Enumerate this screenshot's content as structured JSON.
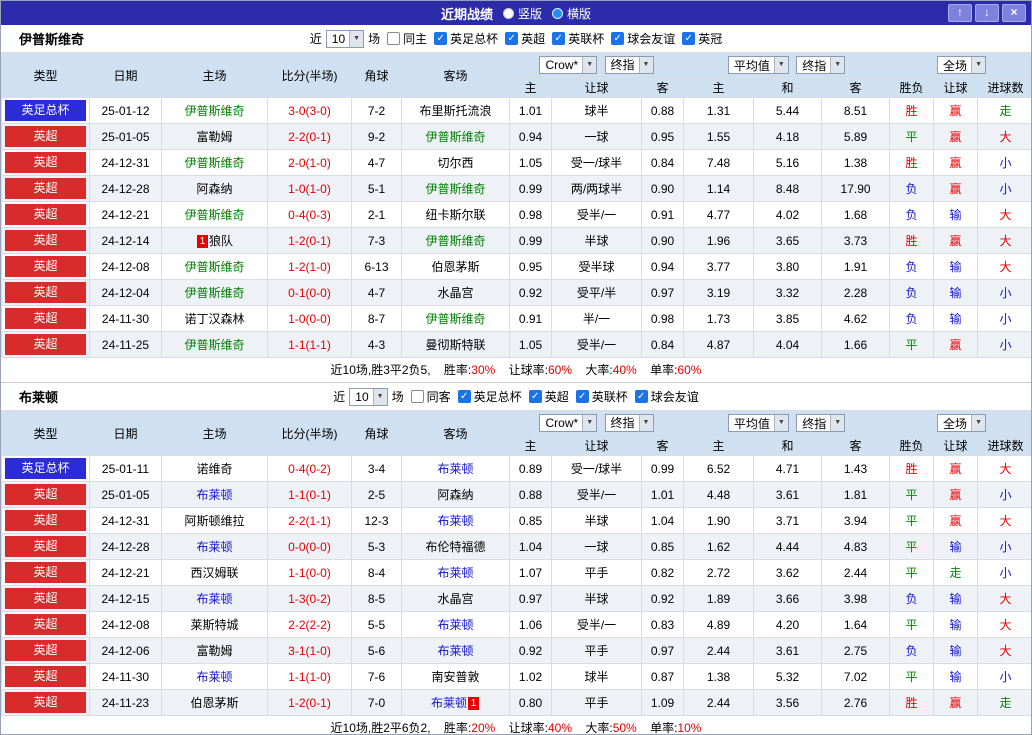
{
  "titlebar": {
    "title": "近期战绩",
    "view_options": [
      {
        "label": "竖版",
        "selected": false
      },
      {
        "label": "横版",
        "selected": true
      }
    ],
    "up_icon": "↑",
    "down_icon": "↓",
    "close_icon": "×"
  },
  "colors": {
    "titlebar_bg": "#2c2cab",
    "header_bg": "#cfe0f1",
    "league_red": "#d92b2b",
    "cup_blue": "#2b2bd9",
    "win_red": "#e60000",
    "draw_green": "#008800",
    "lose_blue": "#1414d9"
  },
  "sections": [
    {
      "team": "伊普斯维奇",
      "team_color": "#008000",
      "filter": {
        "near": "近",
        "count": "10",
        "games": "场",
        "same": {
          "label": "同主",
          "checked": false
        },
        "competitions": [
          {
            "label": "英足总杯",
            "checked": true
          },
          {
            "label": "英超",
            "checked": true
          },
          {
            "label": "英联杯",
            "checked": true
          },
          {
            "label": "球会友谊",
            "checked": true
          },
          {
            "label": "英冠",
            "checked": true
          }
        ]
      },
      "header": {
        "type": "类型",
        "date": "日期",
        "home": "主场",
        "score": "比分(半场)",
        "corner": "角球",
        "away": "客场",
        "company": "Crow*",
        "final1": "终指",
        "average": "平均值",
        "final2": "终指",
        "fulltime": "全场",
        "sub": [
          "主",
          "让球",
          "客",
          "主",
          "和",
          "客",
          "胜负",
          "让球",
          "进球数"
        ]
      },
      "rows": [
        {
          "type": "英足总杯",
          "type_color": "blue",
          "date": "25-01-12",
          "home": "伊普斯维奇",
          "home_subject": true,
          "home_card": "",
          "score": "3-0(3-0)",
          "corner": "7-2",
          "away": "布里斯托流浪",
          "away_subject": false,
          "away_card": "",
          "odds": [
            "1.01",
            "球半",
            "0.88"
          ],
          "avg": [
            "1.31",
            "5.44",
            "8.51"
          ],
          "res": [
            "胜",
            "赢",
            "走"
          ],
          "rc": [
            "red",
            "red",
            "green"
          ]
        },
        {
          "type": "英超",
          "type_color": "red",
          "date": "25-01-05",
          "home": "富勒姆",
          "home_subject": false,
          "home_card": "",
          "score": "2-2(0-1)",
          "corner": "9-2",
          "away": "伊普斯维奇",
          "away_subject": true,
          "away_card": "",
          "odds": [
            "0.94",
            "一球",
            "0.95"
          ],
          "avg": [
            "1.55",
            "4.18",
            "5.89"
          ],
          "res": [
            "平",
            "赢",
            "大"
          ],
          "rc": [
            "green",
            "red",
            "red"
          ]
        },
        {
          "type": "英超",
          "type_color": "red",
          "date": "24-12-31",
          "home": "伊普斯维奇",
          "home_subject": true,
          "home_card": "",
          "score": "2-0(1-0)",
          "corner": "4-7",
          "away": "切尔西",
          "away_subject": false,
          "away_card": "",
          "odds": [
            "1.05",
            "受一/球半",
            "0.84"
          ],
          "avg": [
            "7.48",
            "5.16",
            "1.38"
          ],
          "res": [
            "胜",
            "赢",
            "小"
          ],
          "rc": [
            "red",
            "red",
            "blue"
          ]
        },
        {
          "type": "英超",
          "type_color": "red",
          "date": "24-12-28",
          "home": "阿森纳",
          "home_subject": false,
          "home_card": "",
          "score": "1-0(1-0)",
          "corner": "5-1",
          "away": "伊普斯维奇",
          "away_subject": true,
          "away_card": "",
          "odds": [
            "0.99",
            "两/两球半",
            "0.90"
          ],
          "avg": [
            "1.14",
            "8.48",
            "17.90"
          ],
          "res": [
            "负",
            "赢",
            "小"
          ],
          "rc": [
            "blue",
            "red",
            "blue"
          ]
        },
        {
          "type": "英超",
          "type_color": "red",
          "date": "24-12-21",
          "home": "伊普斯维奇",
          "home_subject": true,
          "home_card": "",
          "score": "0-4(0-3)",
          "corner": "2-1",
          "away": "纽卡斯尔联",
          "away_subject": false,
          "away_card": "",
          "odds": [
            "0.98",
            "受半/一",
            "0.91"
          ],
          "avg": [
            "4.77",
            "4.02",
            "1.68"
          ],
          "res": [
            "负",
            "输",
            "大"
          ],
          "rc": [
            "blue",
            "blue",
            "red"
          ]
        },
        {
          "type": "英超",
          "type_color": "red",
          "date": "24-12-14",
          "home": "狼队",
          "home_subject": false,
          "home_card": "1",
          "score": "1-2(0-1)",
          "corner": "7-3",
          "away": "伊普斯维奇",
          "away_subject": true,
          "away_card": "",
          "odds": [
            "0.99",
            "半球",
            "0.90"
          ],
          "avg": [
            "1.96",
            "3.65",
            "3.73"
          ],
          "res": [
            "胜",
            "赢",
            "大"
          ],
          "rc": [
            "red",
            "red",
            "red"
          ]
        },
        {
          "type": "英超",
          "type_color": "red",
          "date": "24-12-08",
          "home": "伊普斯维奇",
          "home_subject": true,
          "home_card": "",
          "score": "1-2(1-0)",
          "corner": "6-13",
          "away": "伯恩茅斯",
          "away_subject": false,
          "away_card": "",
          "odds": [
            "0.95",
            "受半球",
            "0.94"
          ],
          "avg": [
            "3.77",
            "3.80",
            "1.91"
          ],
          "res": [
            "负",
            "输",
            "大"
          ],
          "rc": [
            "blue",
            "blue",
            "red"
          ]
        },
        {
          "type": "英超",
          "type_color": "red",
          "date": "24-12-04",
          "home": "伊普斯维奇",
          "home_subject": true,
          "home_card": "",
          "score": "0-1(0-0)",
          "corner": "4-7",
          "away": "水晶宫",
          "away_subject": false,
          "away_card": "",
          "odds": [
            "0.92",
            "受平/半",
            "0.97"
          ],
          "avg": [
            "3.19",
            "3.32",
            "2.28"
          ],
          "res": [
            "负",
            "输",
            "小"
          ],
          "rc": [
            "blue",
            "blue",
            "blue"
          ]
        },
        {
          "type": "英超",
          "type_color": "red",
          "date": "24-11-30",
          "home": "诺丁汉森林",
          "home_subject": false,
          "home_card": "",
          "score": "1-0(0-0)",
          "corner": "8-7",
          "away": "伊普斯维奇",
          "away_subject": true,
          "away_card": "",
          "odds": [
            "0.91",
            "半/一",
            "0.98"
          ],
          "avg": [
            "1.73",
            "3.85",
            "4.62"
          ],
          "res": [
            "负",
            "输",
            "小"
          ],
          "rc": [
            "blue",
            "blue",
            "blue"
          ]
        },
        {
          "type": "英超",
          "type_color": "red",
          "date": "24-11-25",
          "home": "伊普斯维奇",
          "home_subject": true,
          "home_card": "",
          "score": "1-1(1-1)",
          "corner": "4-3",
          "away": "曼彻斯特联",
          "away_subject": false,
          "away_card": "",
          "odds": [
            "1.05",
            "受半/一",
            "0.84"
          ],
          "avg": [
            "4.87",
            "4.04",
            "1.66"
          ],
          "res": [
            "平",
            "赢",
            "小"
          ],
          "rc": [
            "green",
            "red",
            "blue"
          ]
        }
      ],
      "summary": {
        "record": "近10场,胜3平2负5,",
        "stats": [
          {
            "label": "胜率:",
            "value": "30%"
          },
          {
            "label": "让球率:",
            "value": "60%"
          },
          {
            "label": "大率:",
            "value": "40%"
          },
          {
            "label": "单率:",
            "value": "60%"
          }
        ]
      }
    },
    {
      "team": "布莱顿",
      "team_color": "#1414cc",
      "filter": {
        "near": "近",
        "count": "10",
        "games": "场",
        "same": {
          "label": "同客",
          "checked": false
        },
        "competitions": [
          {
            "label": "英足总杯",
            "checked": true
          },
          {
            "label": "英超",
            "checked": true
          },
          {
            "label": "英联杯",
            "checked": true
          },
          {
            "label": "球会友谊",
            "checked": true
          }
        ]
      },
      "header": {
        "type": "类型",
        "date": "日期",
        "home": "主场",
        "score": "比分(半场)",
        "corner": "角球",
        "away": "客场",
        "company": "Crow*",
        "final1": "终指",
        "average": "平均值",
        "final2": "终指",
        "fulltime": "全场",
        "sub": [
          "主",
          "让球",
          "客",
          "主",
          "和",
          "客",
          "胜负",
          "让球",
          "进球数"
        ]
      },
      "rows": [
        {
          "type": "英足总杯",
          "type_color": "blue",
          "date": "25-01-11",
          "home": "诺维奇",
          "home_subject": false,
          "home_card": "",
          "score": "0-4(0-2)",
          "corner": "3-4",
          "away": "布莱顿",
          "away_subject": true,
          "away_card": "",
          "odds": [
            "0.89",
            "受一/球半",
            "0.99"
          ],
          "avg": [
            "6.52",
            "4.71",
            "1.43"
          ],
          "res": [
            "胜",
            "赢",
            "大"
          ],
          "rc": [
            "red",
            "red",
            "red"
          ]
        },
        {
          "type": "英超",
          "type_color": "red",
          "date": "25-01-05",
          "home": "布莱顿",
          "home_subject": true,
          "home_card": "",
          "score": "1-1(0-1)",
          "corner": "2-5",
          "away": "阿森纳",
          "away_subject": false,
          "away_card": "",
          "odds": [
            "0.88",
            "受半/一",
            "1.01"
          ],
          "avg": [
            "4.48",
            "3.61",
            "1.81"
          ],
          "res": [
            "平",
            "赢",
            "小"
          ],
          "rc": [
            "green",
            "red",
            "blue"
          ]
        },
        {
          "type": "英超",
          "type_color": "red",
          "date": "24-12-31",
          "home": "阿斯顿维拉",
          "home_subject": false,
          "home_card": "",
          "score": "2-2(1-1)",
          "corner": "12-3",
          "away": "布莱顿",
          "away_subject": true,
          "away_card": "",
          "odds": [
            "0.85",
            "半球",
            "1.04"
          ],
          "avg": [
            "1.90",
            "3.71",
            "3.94"
          ],
          "res": [
            "平",
            "赢",
            "大"
          ],
          "rc": [
            "green",
            "red",
            "red"
          ]
        },
        {
          "type": "英超",
          "type_color": "red",
          "date": "24-12-28",
          "home": "布莱顿",
          "home_subject": true,
          "home_card": "",
          "score": "0-0(0-0)",
          "corner": "5-3",
          "away": "布伦特福德",
          "away_subject": false,
          "away_card": "",
          "odds": [
            "1.04",
            "一球",
            "0.85"
          ],
          "avg": [
            "1.62",
            "4.44",
            "4.83"
          ],
          "res": [
            "平",
            "输",
            "小"
          ],
          "rc": [
            "green",
            "blue",
            "blue"
          ]
        },
        {
          "type": "英超",
          "type_color": "red",
          "date": "24-12-21",
          "home": "西汉姆联",
          "home_subject": false,
          "home_card": "",
          "score": "1-1(0-0)",
          "corner": "8-4",
          "away": "布莱顿",
          "away_subject": true,
          "away_card": "",
          "odds": [
            "1.07",
            "平手",
            "0.82"
          ],
          "avg": [
            "2.72",
            "3.62",
            "2.44"
          ],
          "res": [
            "平",
            "走",
            "小"
          ],
          "rc": [
            "green",
            "green",
            "blue"
          ]
        },
        {
          "type": "英超",
          "type_color": "red",
          "date": "24-12-15",
          "home": "布莱顿",
          "home_subject": true,
          "home_card": "",
          "score": "1-3(0-2)",
          "corner": "8-5",
          "away": "水晶宫",
          "away_subject": false,
          "away_card": "",
          "odds": [
            "0.97",
            "半球",
            "0.92"
          ],
          "avg": [
            "1.89",
            "3.66",
            "3.98"
          ],
          "res": [
            "负",
            "输",
            "大"
          ],
          "rc": [
            "blue",
            "blue",
            "red"
          ]
        },
        {
          "type": "英超",
          "type_color": "red",
          "date": "24-12-08",
          "home": "莱斯特城",
          "home_subject": false,
          "home_card": "",
          "score": "2-2(2-2)",
          "corner": "5-5",
          "away": "布莱顿",
          "away_subject": true,
          "away_card": "",
          "odds": [
            "1.06",
            "受半/一",
            "0.83"
          ],
          "avg": [
            "4.89",
            "4.20",
            "1.64"
          ],
          "res": [
            "平",
            "输",
            "大"
          ],
          "rc": [
            "green",
            "blue",
            "red"
          ]
        },
        {
          "type": "英超",
          "type_color": "red",
          "date": "24-12-06",
          "home": "富勒姆",
          "home_subject": false,
          "home_card": "",
          "score": "3-1(1-0)",
          "corner": "5-6",
          "away": "布莱顿",
          "away_subject": true,
          "away_card": "",
          "odds": [
            "0.92",
            "平手",
            "0.97"
          ],
          "avg": [
            "2.44",
            "3.61",
            "2.75"
          ],
          "res": [
            "负",
            "输",
            "大"
          ],
          "rc": [
            "blue",
            "blue",
            "red"
          ]
        },
        {
          "type": "英超",
          "type_color": "red",
          "date": "24-11-30",
          "home": "布莱顿",
          "home_subject": true,
          "home_card": "",
          "score": "1-1(1-0)",
          "corner": "7-6",
          "away": "南安普敦",
          "away_subject": false,
          "away_card": "",
          "odds": [
            "1.02",
            "球半",
            "0.87"
          ],
          "avg": [
            "1.38",
            "5.32",
            "7.02"
          ],
          "res": [
            "平",
            "输",
            "小"
          ],
          "rc": [
            "green",
            "blue",
            "blue"
          ]
        },
        {
          "type": "英超",
          "type_color": "red",
          "date": "24-11-23",
          "home": "伯恩茅斯",
          "home_subject": false,
          "home_card": "",
          "score": "1-2(0-1)",
          "corner": "7-0",
          "away": "布莱顿",
          "away_subject": true,
          "away_card": "1",
          "odds": [
            "0.80",
            "平手",
            "1.09"
          ],
          "avg": [
            "2.44",
            "3.56",
            "2.76"
          ],
          "res": [
            "胜",
            "赢",
            "走"
          ],
          "rc": [
            "red",
            "red",
            "green"
          ]
        }
      ],
      "summary": {
        "record": "近10场,胜2平6负2,",
        "stats": [
          {
            "label": "胜率:",
            "value": "20%"
          },
          {
            "label": "让球率:",
            "value": "40%"
          },
          {
            "label": "大率:",
            "value": "50%"
          },
          {
            "label": "单率:",
            "value": "10%"
          }
        ]
      }
    }
  ]
}
